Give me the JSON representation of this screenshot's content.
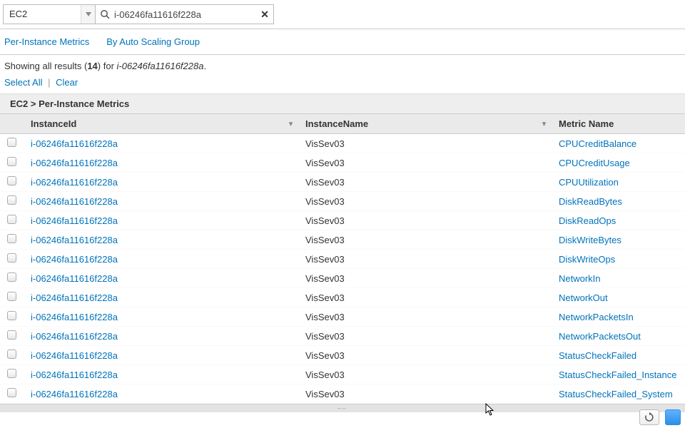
{
  "filter": {
    "namespace": "EC2",
    "search_value": "i-06246fa11616f228a"
  },
  "tabs": {
    "per_instance": "Per-Instance Metrics",
    "by_asg": "By Auto Scaling Group"
  },
  "summary": {
    "prefix": "Showing all results (",
    "count": "14",
    "mid": ") for ",
    "query": "i-06246fa11616f228a",
    "suffix": "."
  },
  "actions": {
    "select_all": "Select All",
    "clear": "Clear"
  },
  "breadcrumb": "EC2 > Per-Instance Metrics",
  "columns": {
    "instance_id": "InstanceId",
    "instance_name": "InstanceName",
    "metric_name": "Metric Name"
  },
  "rows": [
    {
      "id": "i-06246fa11616f228a",
      "name": "VisSev03",
      "metric": "CPUCreditBalance"
    },
    {
      "id": "i-06246fa11616f228a",
      "name": "VisSev03",
      "metric": "CPUCreditUsage"
    },
    {
      "id": "i-06246fa11616f228a",
      "name": "VisSev03",
      "metric": "CPUUtilization"
    },
    {
      "id": "i-06246fa11616f228a",
      "name": "VisSev03",
      "metric": "DiskReadBytes"
    },
    {
      "id": "i-06246fa11616f228a",
      "name": "VisSev03",
      "metric": "DiskReadOps"
    },
    {
      "id": "i-06246fa11616f228a",
      "name": "VisSev03",
      "metric": "DiskWriteBytes"
    },
    {
      "id": "i-06246fa11616f228a",
      "name": "VisSev03",
      "metric": "DiskWriteOps"
    },
    {
      "id": "i-06246fa11616f228a",
      "name": "VisSev03",
      "metric": "NetworkIn"
    },
    {
      "id": "i-06246fa11616f228a",
      "name": "VisSev03",
      "metric": "NetworkOut"
    },
    {
      "id": "i-06246fa11616f228a",
      "name": "VisSev03",
      "metric": "NetworkPacketsIn"
    },
    {
      "id": "i-06246fa11616f228a",
      "name": "VisSev03",
      "metric": "NetworkPacketsOut"
    },
    {
      "id": "i-06246fa11616f228a",
      "name": "VisSev03",
      "metric": "StatusCheckFailed"
    },
    {
      "id": "i-06246fa11616f228a",
      "name": "VisSev03",
      "metric": "StatusCheckFailed_Instance"
    },
    {
      "id": "i-06246fa11616f228a",
      "name": "VisSev03",
      "metric": "StatusCheckFailed_System"
    }
  ]
}
